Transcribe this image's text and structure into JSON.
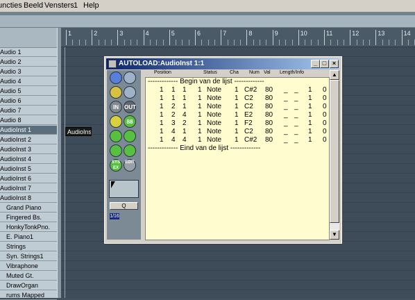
{
  "menu": [
    "uncties",
    "Beeld",
    "Vensters",
    "1",
    "Help"
  ],
  "tracks": [
    {
      "name": "Audio 1"
    },
    {
      "name": "Audio 2"
    },
    {
      "name": "Audio 3"
    },
    {
      "name": "Audio 4"
    },
    {
      "name": "Audio 5"
    },
    {
      "name": "Audio 6"
    },
    {
      "name": "Audio 7"
    },
    {
      "name": "Audio 8"
    },
    {
      "name": "AudioInst  1",
      "selected": true
    },
    {
      "name": "AudioInst  2"
    },
    {
      "name": "AudioInst  3"
    },
    {
      "name": "AudioInst  4"
    },
    {
      "name": "AudioInst  5"
    },
    {
      "name": "AudioInst  6"
    },
    {
      "name": "AudioInst  7"
    },
    {
      "name": "AudioInst  8"
    },
    {
      "name": "Grand Piano"
    },
    {
      "name": "Fingered Bs."
    },
    {
      "name": "HonkyTonkPno."
    },
    {
      "name": "E. Piano1"
    },
    {
      "name": "Strings"
    },
    {
      "name": "Syn. Strings1"
    },
    {
      "name": "Vibraphone"
    },
    {
      "name": "Muted Gt."
    },
    {
      "name": "DrawOrgan"
    },
    {
      "name": "rums Mapped"
    }
  ],
  "ruler": {
    "bars": [
      "1",
      "2",
      "3",
      "4",
      "5",
      "6",
      "7",
      "8",
      "9",
      "10",
      "11",
      "12",
      "13",
      "14"
    ]
  },
  "part": {
    "label": "AudioInst"
  },
  "list_editor": {
    "title": "AUTOLOAD:AudioInst  1:1",
    "columns": [
      "Position",
      "Status",
      "Cha",
      "Num",
      "Val",
      "Length/Info"
    ],
    "begin_marker": "------------- Begin van de lijst -------------",
    "end_marker": "------------- Eind van de lijst -------------",
    "events": [
      {
        "b1": "1",
        "b2": "1",
        "b3": "1",
        "b4": "1",
        "status": "Note",
        "cha": "1",
        "num": "C#2",
        "val": "80",
        "d1": "_",
        "d2": "_",
        "l1": "1",
        "l2": "0"
      },
      {
        "b1": "1",
        "b2": "1",
        "b3": "1",
        "b4": "1",
        "status": "Note",
        "cha": "1",
        "num": "C2",
        "val": "80",
        "d1": "_",
        "d2": "_",
        "l1": "1",
        "l2": "0"
      },
      {
        "b1": "1",
        "b2": "2",
        "b3": "1",
        "b4": "1",
        "status": "Note",
        "cha": "1",
        "num": "C2",
        "val": "80",
        "d1": "_",
        "d2": "_",
        "l1": "1",
        "l2": "0"
      },
      {
        "b1": "1",
        "b2": "2",
        "b3": "4",
        "b4": "1",
        "status": "Note",
        "cha": "1",
        "num": "E2",
        "val": "80",
        "d1": "_",
        "d2": "_",
        "l1": "1",
        "l2": "0"
      },
      {
        "b1": "1",
        "b2": "3",
        "b3": "2",
        "b4": "1",
        "status": "Note",
        "cha": "1",
        "num": "F2",
        "val": "80",
        "d1": "_",
        "d2": "_",
        "l1": "1",
        "l2": "0"
      },
      {
        "b1": "1",
        "b2": "4",
        "b3": "1",
        "b4": "1",
        "status": "Note",
        "cha": "1",
        "num": "C2",
        "val": "80",
        "d1": "_",
        "d2": "_",
        "l1": "1",
        "l2": "0"
      },
      {
        "b1": "1",
        "b2": "4",
        "b3": "4",
        "b4": "1",
        "status": "Note",
        "cha": "1",
        "num": "C#2",
        "val": "80",
        "d1": "_",
        "d2": "_",
        "l1": "1",
        "l2": "0"
      }
    ],
    "tools": [
      {
        "name": "pointer-tool-icon",
        "label": "",
        "color": "#5a7fd8"
      },
      {
        "name": "eraser-tool-icon",
        "label": "",
        "color": "#9fb2c8"
      },
      {
        "name": "scissors-tool-icon",
        "label": "",
        "color": "#d8c040"
      },
      {
        "name": "glue-tool-icon",
        "label": "",
        "color": "#9fb2c8"
      },
      {
        "name": "in-button-icon",
        "label": "IN",
        "color": "#808890"
      },
      {
        "name": "out-button-icon",
        "label": "OUT",
        "color": "#606870"
      },
      {
        "name": "note-icon",
        "label": "",
        "color": "#d8d040"
      },
      {
        "name": "eighty-eight-icon",
        "label": "88",
        "color": "#58c040"
      },
      {
        "name": "fader-icon",
        "label": "",
        "color": "#58c040"
      },
      {
        "name": "fader2-icon",
        "label": "",
        "color": "#58c040"
      },
      {
        "name": "figure-icon",
        "label": "",
        "color": "#58c040"
      },
      {
        "name": "figure2-icon",
        "label": "",
        "color": "#58c040"
      },
      {
        "name": "sysex-icon",
        "label": "SYS EX",
        "color": "#58c040"
      },
      {
        "name": "edit-icon",
        "label": "EDIT",
        "color": "#9aa0a8"
      }
    ],
    "quantize_label": "Q",
    "quantize_value": "1/16"
  }
}
